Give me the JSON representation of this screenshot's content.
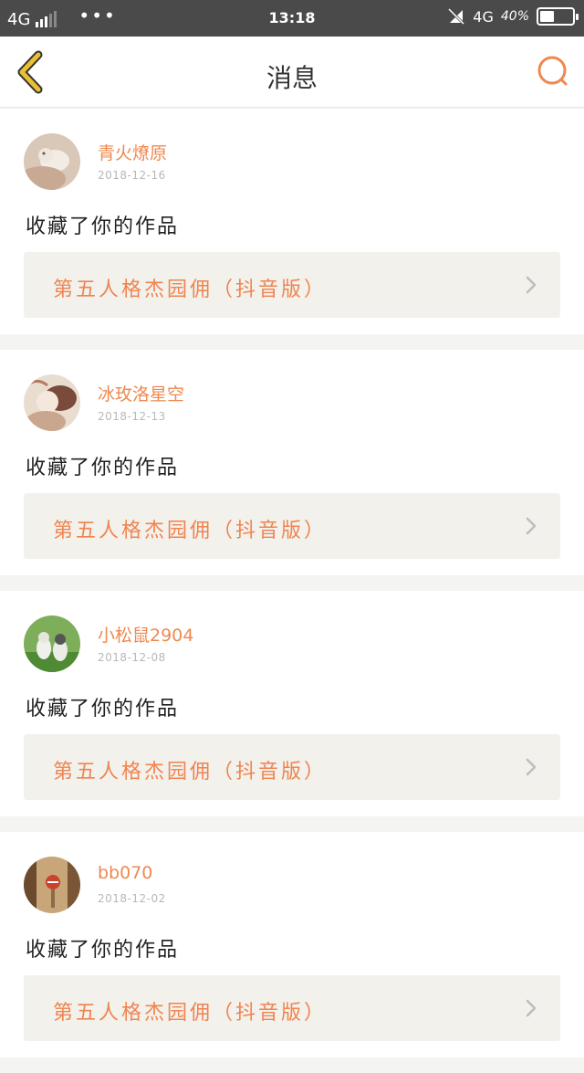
{
  "status_bar": {
    "network": "4G",
    "time": "13:18",
    "network_right": "4G",
    "battery": "40%",
    "battery_level": 0.4
  },
  "header": {
    "title": "消息",
    "back_icon": "chevron-left-icon",
    "search_icon": "search-icon"
  },
  "colors": {
    "accent": "#f0884f",
    "back_icon": "#e8c032",
    "card_bg": "#f2f1ec"
  },
  "messages": [
    {
      "username": "青火燎原",
      "date": "2018-12-16",
      "action": "收藏了你的作品",
      "work_title": "第五人格杰园佣（抖音版）"
    },
    {
      "username": "冰玫洛星空",
      "date": "2018-12-13",
      "action": "收藏了你的作品",
      "work_title": "第五人格杰园佣（抖音版）"
    },
    {
      "username": "小松鼠2904",
      "date": "2018-12-08",
      "action": "收藏了你的作品",
      "work_title": "第五人格杰园佣（抖音版）"
    },
    {
      "username": "bb070",
      "date": "2018-12-02",
      "action": "收藏了你的作品",
      "work_title": "第五人格杰园佣（抖音版）"
    }
  ]
}
